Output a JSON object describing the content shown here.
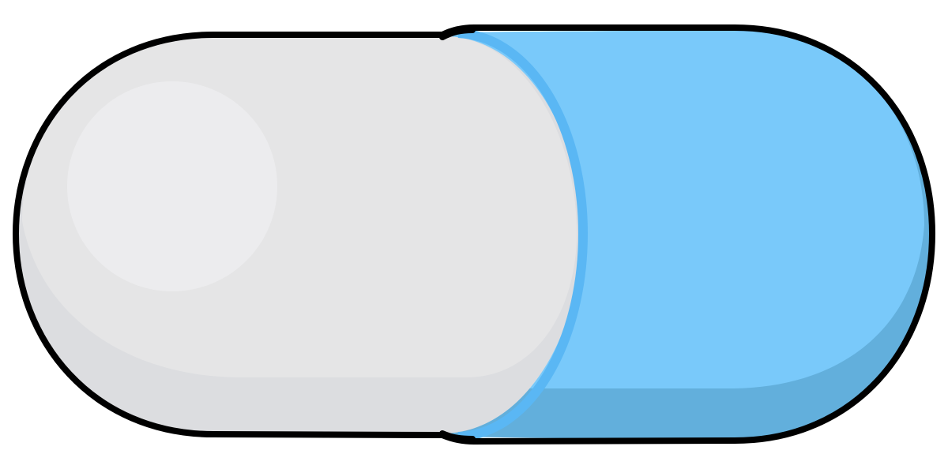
{
  "illustration": {
    "subject": "capsule-pill-icon",
    "colors": {
      "outline": "#000000",
      "white_half_face": "#e5e5e6",
      "white_half_shadow": "#dcdde0",
      "white_half_highlight": "#ececee",
      "blue_half_face": "#79c9fa",
      "blue_half_shadow": "#62afdc",
      "blue_rim": "#5ab7f4"
    }
  }
}
